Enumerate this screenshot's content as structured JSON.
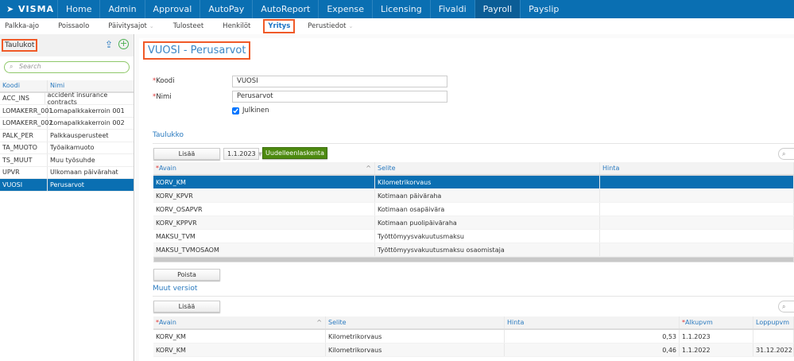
{
  "topnav": {
    "logo": "VISMA",
    "items": [
      "Home",
      "Admin",
      "Approval",
      "AutoPay",
      "AutoReport",
      "Expense",
      "Licensing",
      "Fivaldi",
      "Payroll",
      "Payslip"
    ],
    "active": "Payroll"
  },
  "subnav": {
    "items": [
      "Palkka-ajo",
      "Poissaolo",
      "Päivitysajot",
      "Tulosteet",
      "Henkilöt",
      "Yritys",
      "Perustiedot"
    ],
    "active": "Yritys"
  },
  "sidebar": {
    "title": "Taulukot",
    "search_placeholder": "Search",
    "columns": [
      "Koodi",
      "Nimi"
    ],
    "rows": [
      [
        "ACC_INS",
        "accident insurance contracts"
      ],
      [
        "LOMAKERR_001",
        "Lomapalkkakerroin 001"
      ],
      [
        "LOMAKERR_002",
        "Lomapalkkakerroin 002"
      ],
      [
        "PALK_PER",
        "Palkkausperusteet"
      ],
      [
        "TA_MUOTO",
        "Työaikamuoto"
      ],
      [
        "TS_MUUT",
        "Muu työsuhde"
      ],
      [
        "UPVR",
        "Ulkomaan päivärahat"
      ],
      [
        "VUOSI",
        "Perusarvot"
      ]
    ],
    "selected": "VUOSI"
  },
  "main": {
    "title": "VUOSI - Perusarvot",
    "form": {
      "koodi_label": "Koodi",
      "koodi_value": "VUOSI",
      "nimi_label": "Nimi",
      "nimi_value": "Perusarvot",
      "julkinen_label": "Julkinen",
      "julkinen_checked": true
    },
    "taulukko": {
      "title": "Taulukko",
      "add": "Lisää",
      "date": "1.1.2023",
      "recalc": "Uudelleenlaskenta",
      "delete": "Poista",
      "columns": [
        "Avain",
        "Selite",
        "Hinta"
      ],
      "rows": [
        [
          "KORV_KM",
          "Kilometrikorvaus",
          ""
        ],
        [
          "KORV_KPVR",
          "Kotimaan päiväraha",
          ""
        ],
        [
          "KORV_OSAPVR",
          "Kotimaan osapäivära",
          ""
        ],
        [
          "KORV_KPPVR",
          "Kotimaan puolipäiväraha",
          ""
        ],
        [
          "MAKSU_TVM",
          "Työttömyysvakuutusmaksu",
          ""
        ],
        [
          "MAKSU_TVMOSAOM",
          "Työttömyysvakuutusmaksu osaomistaja",
          ""
        ]
      ]
    },
    "muut": {
      "title": "Muut versiot",
      "add": "Lisää",
      "columns": [
        "Avain",
        "Selite",
        "Hinta",
        "Alkupvm",
        "Loppupvm"
      ],
      "rows": [
        [
          "KORV_KM",
          "Kilometrikorvaus",
          "0,53",
          "1.1.2023",
          ""
        ],
        [
          "KORV_KM",
          "Kilometrikorvaus",
          "0,46",
          "1.1.2022",
          "31.12.2022"
        ]
      ]
    }
  },
  "colors": {
    "brand": "#0a6fb2",
    "highlight": "#f05a28",
    "recalc": "#4d8a10"
  }
}
